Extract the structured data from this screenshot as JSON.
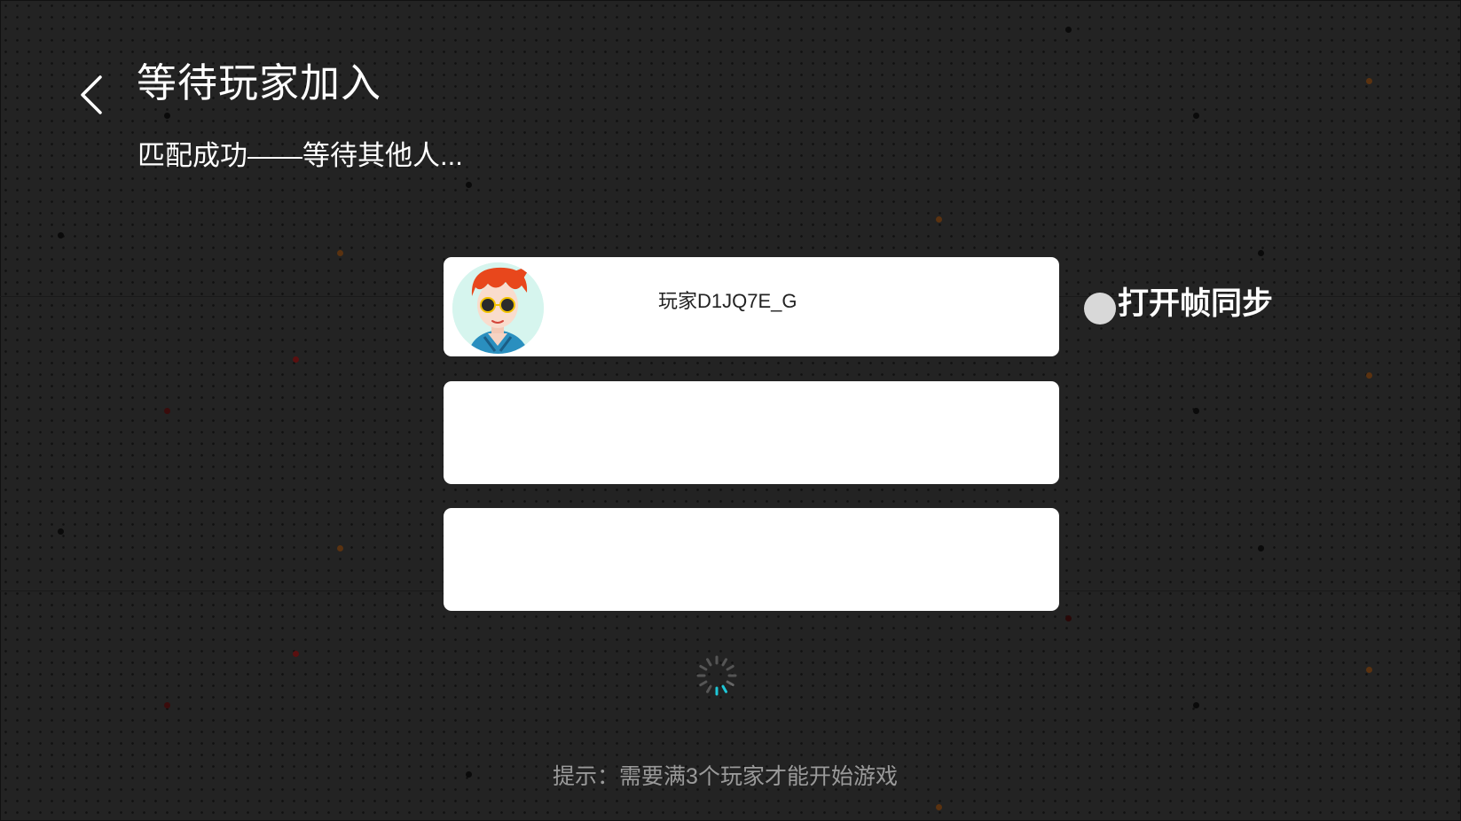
{
  "header": {
    "title": "等待玩家加入",
    "subtitle": "匹配成功——等待其他人..."
  },
  "players": [
    {
      "name": "玩家D1JQ7E_G",
      "avatar": "red-haired-avatar-with-sunglasses"
    },
    {
      "name": ""
    },
    {
      "name": ""
    }
  ],
  "frame_sync": {
    "label": "打开帧同步",
    "enabled": false
  },
  "hint": "提示：需要满3个玩家才能开始游戏",
  "colors": {
    "background": "#232323",
    "slot": "#ffffff",
    "spinner_accent": "#1ec8d8"
  }
}
